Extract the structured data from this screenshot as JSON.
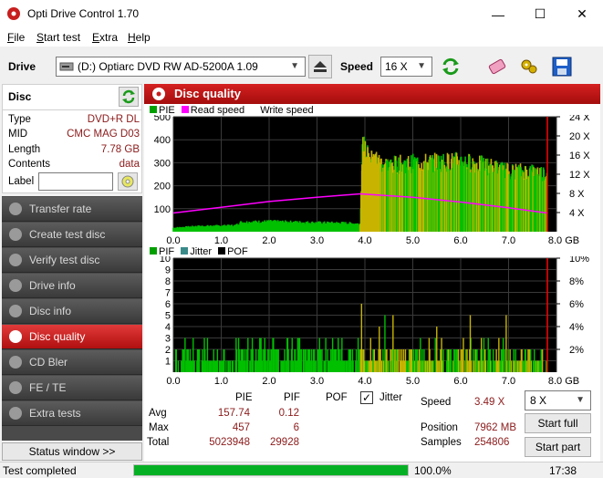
{
  "window": {
    "title": "Opti Drive Control 1.70",
    "minimize": "—",
    "maximize": "☐",
    "close": "✕"
  },
  "menu": [
    "File",
    "Start test",
    "Extra",
    "Help"
  ],
  "drive": {
    "label": "Drive",
    "selected": "(D:)   Optiarc DVD RW AD-5200A 1.09",
    "speed_label": "Speed",
    "speed_selected": "16 X"
  },
  "disc": {
    "header": "Disc",
    "type_label": "Type",
    "type_value": "DVD+R DL",
    "mid_label": "MID",
    "mid_value": "CMC MAG D03",
    "length_label": "Length",
    "length_value": "7.78 GB",
    "contents_label": "Contents",
    "contents_value": "data",
    "label_label": "Label",
    "label_value": ""
  },
  "nav": [
    {
      "label": "Transfer rate",
      "active": false
    },
    {
      "label": "Create test disc",
      "active": false
    },
    {
      "label": "Verify test disc",
      "active": false
    },
    {
      "label": "Drive info",
      "active": false
    },
    {
      "label": "Disc info",
      "active": false
    },
    {
      "label": "Disc quality",
      "active": true
    },
    {
      "label": "CD Bler",
      "active": false
    },
    {
      "label": "FE / TE",
      "active": false
    },
    {
      "label": "Extra tests",
      "active": false
    }
  ],
  "status_window_button": "Status window >>",
  "panel_title": "Disc quality",
  "chart_data": [
    {
      "type": "area",
      "legend": [
        "PIE",
        "Read speed",
        "Write speed"
      ],
      "colors": {
        "pie": "#00c000",
        "read": "#ff00ff",
        "overlay": "#c8b400",
        "grid": "#1a1a1a",
        "marker": "#ff0000"
      },
      "x_ticks": [
        "0.0",
        "1.0",
        "2.0",
        "3.0",
        "4.0",
        "5.0",
        "6.0",
        "7.0",
        "8.0 GB"
      ],
      "y_left_ticks": [
        "500",
        "400",
        "300",
        "200",
        "100"
      ],
      "y_right_ticks": [
        "24 X",
        "20 X",
        "16 X",
        "12 X",
        "8 X",
        "4 X"
      ],
      "ylim": [
        0,
        500
      ],
      "xlim": [
        0,
        8.0
      ],
      "layer_break_gb": 3.9,
      "pie_envelope": [
        [
          0.0,
          20
        ],
        [
          0.5,
          28
        ],
        [
          1.3,
          32
        ],
        [
          1.4,
          48
        ],
        [
          2.0,
          52
        ],
        [
          3.0,
          46
        ],
        [
          3.6,
          44
        ],
        [
          3.9,
          40
        ],
        [
          3.95,
          430
        ],
        [
          4.1,
          360
        ],
        [
          4.5,
          330
        ],
        [
          5.0,
          340
        ],
        [
          5.5,
          345
        ],
        [
          6.0,
          350
        ],
        [
          6.5,
          330
        ],
        [
          7.0,
          300
        ],
        [
          7.5,
          300
        ],
        [
          7.8,
          290
        ]
      ],
      "read_speed_x": [
        [
          0.0,
          3.9
        ],
        [
          1.0,
          5.1
        ],
        [
          2.0,
          6.3
        ],
        [
          3.0,
          7.2
        ],
        [
          3.9,
          7.9
        ],
        [
          5.0,
          7.2
        ],
        [
          6.0,
          6.2
        ],
        [
          7.0,
          5.0
        ],
        [
          7.8,
          3.9
        ]
      ]
    },
    {
      "type": "bar",
      "legend": [
        "PIF",
        "Jitter",
        "POF"
      ],
      "colors": {
        "pif": "#00c000",
        "overlay": "#c8b400",
        "grid": "#1a1a1a",
        "marker": "#ff0000"
      },
      "x_ticks": [
        "0.0",
        "1.0",
        "2.0",
        "3.0",
        "4.0",
        "5.0",
        "6.0",
        "7.0",
        "8.0 GB"
      ],
      "y_left_ticks": [
        "10",
        "9",
        "8",
        "7",
        "6",
        "5",
        "4",
        "3",
        "2",
        "1"
      ],
      "y_right_ticks": [
        "10%",
        "8%",
        "6%",
        "4%",
        "2%"
      ],
      "ylim": [
        0,
        10
      ],
      "xlim": [
        0,
        8.0
      ],
      "typical_pif": 2
    }
  ],
  "stats": {
    "col_pie": "PIE",
    "col_pif": "PIF",
    "col_pof": "POF",
    "jitter_label": "Jitter",
    "jitter_checked": true,
    "avg_label": "Avg",
    "avg_pie": "157.74",
    "avg_pif": "0.12",
    "max_label": "Max",
    "max_pie": "457",
    "max_pif": "6",
    "total_label": "Total",
    "total_pie": "5023948",
    "total_pif": "29928",
    "speed_label": "Speed",
    "speed_value": "3.49 X",
    "position_label": "Position",
    "position_value": "7962 MB",
    "samples_label": "Samples",
    "samples_value": "254806",
    "speed_select": "8 X",
    "start_full": "Start full",
    "start_part": "Start part"
  },
  "statusbar": {
    "text": "Test completed",
    "progress": 1.0,
    "progress_text": "100.0%",
    "time": "17:38"
  }
}
